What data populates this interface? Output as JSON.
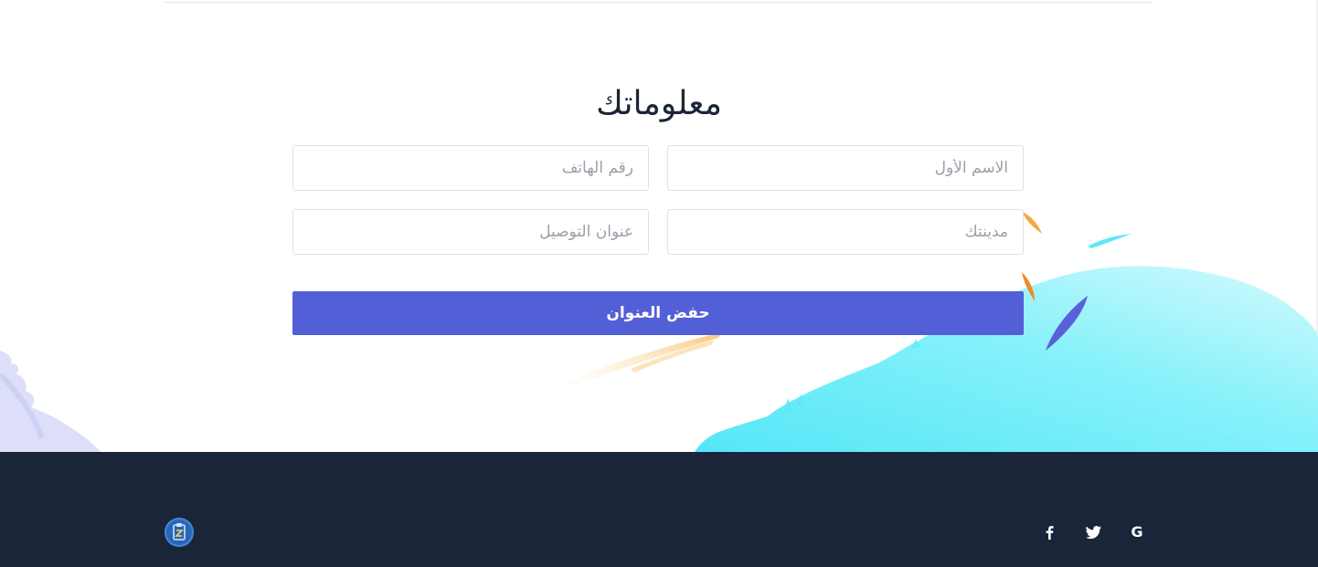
{
  "form": {
    "title": "معلوماتك",
    "first_name_placeholder": "الاسم الأول",
    "phone_placeholder": "رقم الهاتف",
    "city_placeholder": "مدينتك",
    "address_placeholder": "عنوان التوصيل",
    "save_label": "حفض العنوان"
  },
  "colors": {
    "accent": "#535fd7",
    "footer_bg": "#1b253a",
    "title_text": "#1b2437",
    "splash_cyan": "#5ce8f8",
    "splash_light": "#c9f8fc"
  },
  "footer": {
    "logo_icon": "clipboard-logo-icon",
    "social": [
      {
        "name": "google-icon",
        "glyph": "G"
      },
      {
        "name": "twitter-icon"
      },
      {
        "name": "facebook-icon"
      }
    ]
  }
}
